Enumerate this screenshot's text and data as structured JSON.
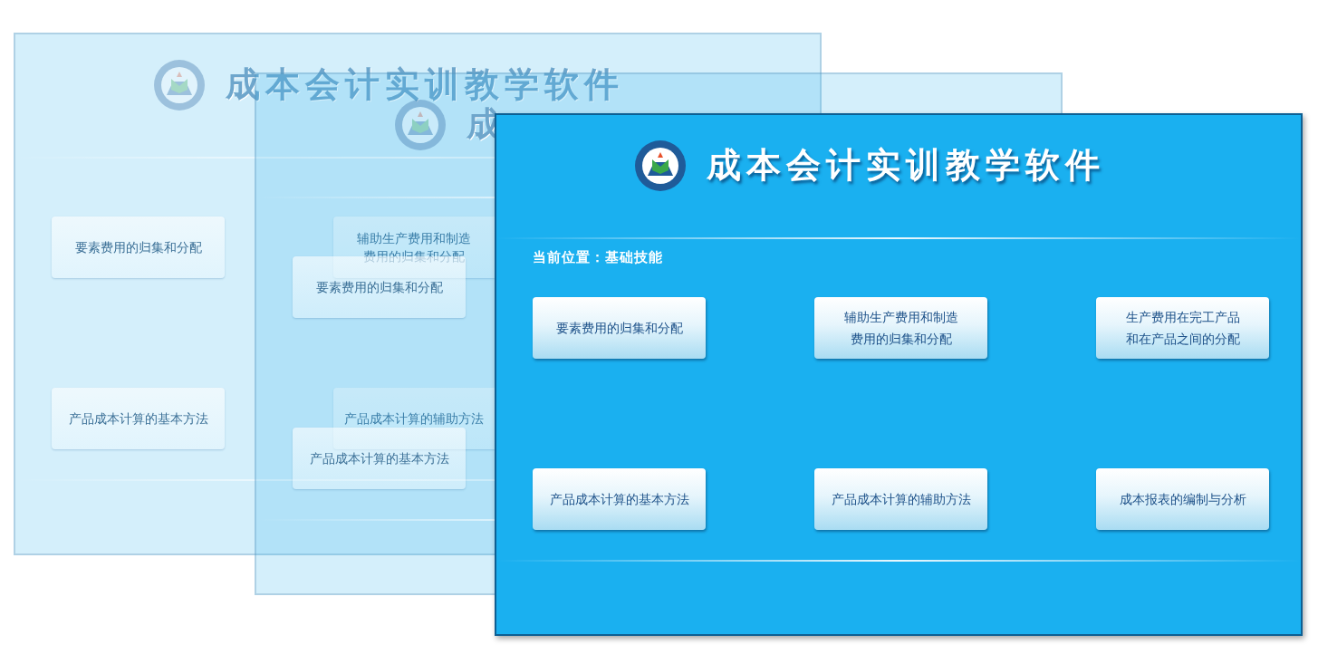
{
  "windows": [
    {
      "faded": true,
      "title": "成本会计实训教学软件",
      "button_rows": [
        [
          {
            "lines": [
              "要素费用的归集和分配"
            ]
          },
          {
            "lines": [
              "辅助生产费用和制造",
              "费用的归集和分配"
            ]
          }
        ],
        [
          {
            "lines": [
              "产品成本计算的基本方法"
            ]
          },
          {
            "lines": [
              "产品成本计算的辅助方法"
            ]
          }
        ]
      ]
    },
    {
      "faded": true,
      "title": "成",
      "button_rows": [
        [
          {
            "lines": [
              "要素费用的归集和分配"
            ]
          }
        ],
        [
          {
            "lines": [
              "产品成本计算的基本方法"
            ]
          }
        ]
      ]
    },
    {
      "faded": false,
      "title": "成本会计实训教学软件",
      "location": "当前位置：基础技能",
      "button_rows": [
        [
          {
            "lines": [
              "要素费用的归集和分配"
            ]
          },
          {
            "lines": [
              "辅助生产费用和制造",
              "费用的归集和分配"
            ]
          },
          {
            "lines": [
              "生产费用在完工产品",
              "和在产品之间的分配"
            ]
          }
        ],
        [
          {
            "lines": [
              "产品成本计算的基本方法"
            ]
          },
          {
            "lines": [
              "产品成本计算的辅助方法"
            ]
          },
          {
            "lines": [
              "成本报表的编制与分析"
            ]
          }
        ]
      ]
    }
  ]
}
